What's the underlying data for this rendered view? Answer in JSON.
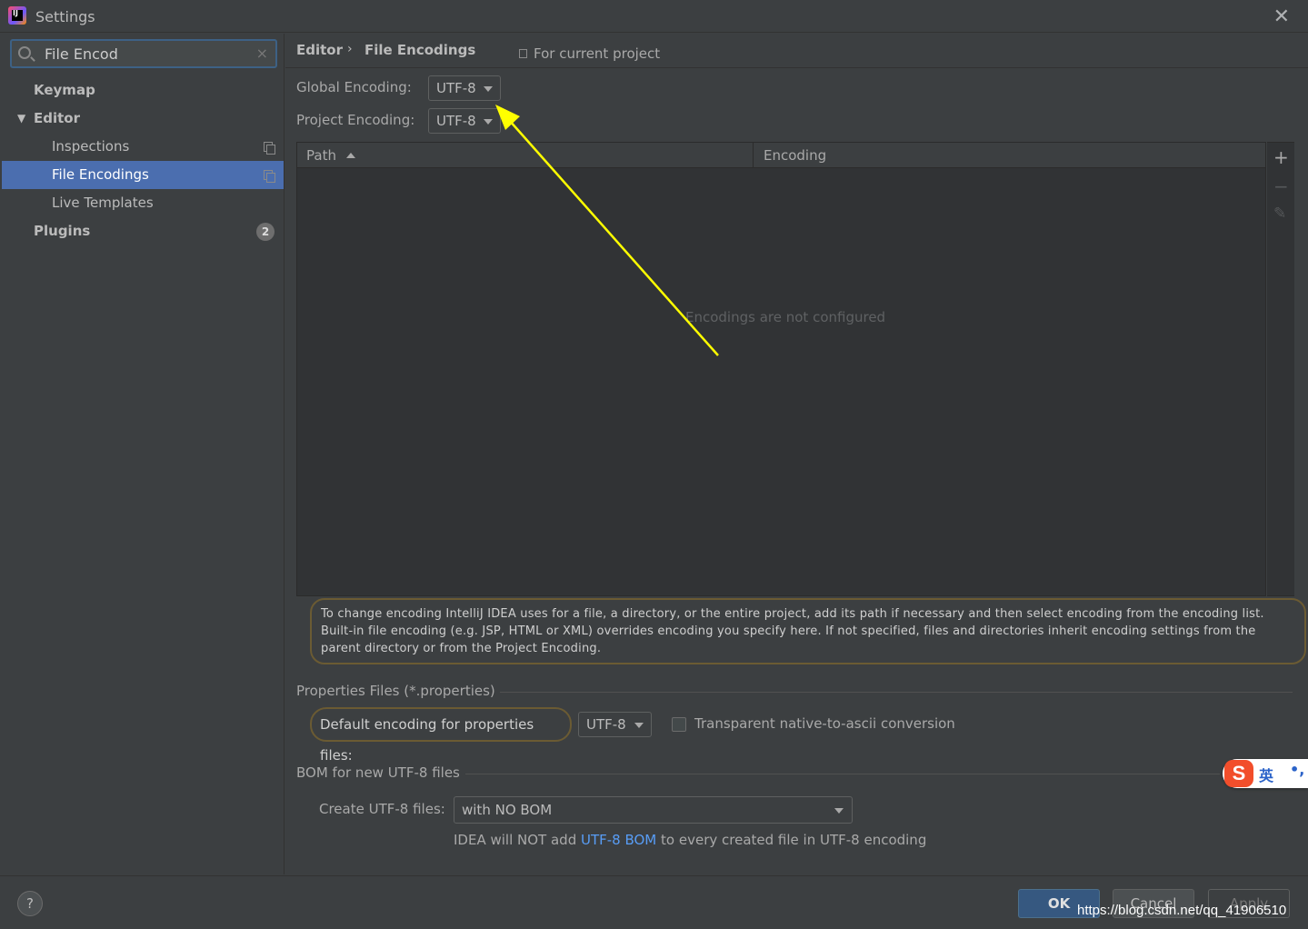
{
  "window": {
    "app_icon": "intellij-idea-icon",
    "title": "Settings",
    "close_glyph": "✕"
  },
  "search": {
    "value": "File Encod",
    "clear_glyph": "×"
  },
  "tree": [
    {
      "label": "Keymap",
      "bold": true,
      "indent": 0,
      "selected": false
    },
    {
      "label": "Editor",
      "bold": true,
      "indent": 0,
      "expanded": true,
      "selected": false
    },
    {
      "label": "Inspections",
      "bold": false,
      "indent": 1,
      "selected": false,
      "project_icon": true
    },
    {
      "label": "File Encodings",
      "bold": false,
      "indent": 1,
      "selected": true,
      "project_icon": true
    },
    {
      "label": "Live Templates",
      "bold": false,
      "indent": 1,
      "selected": false
    },
    {
      "label": "Plugins",
      "bold": true,
      "indent": 0,
      "selected": false,
      "badge": "2"
    }
  ],
  "tree_arrow_glyph": "▼",
  "breadcrumb": {
    "parent": "Editor",
    "separator": "›",
    "current": "File Encodings",
    "scope": "For current project"
  },
  "encodings": {
    "global_label": "Global Encoding:",
    "global_value": "UTF-8",
    "project_label": "Project Encoding:",
    "project_value": "UTF-8"
  },
  "table": {
    "col_path": "Path",
    "col_encoding": "Encoding",
    "empty_text": "Encodings are not configured",
    "add_glyph": "+",
    "remove_glyph": "−",
    "edit_glyph": "✎"
  },
  "info_text": "To change encoding IntelliJ IDEA uses for a file, a directory, or the entire project, add its path if necessary and then select encoding from the encoding list. Built-in file encoding (e.g. JSP, HTML or XML) overrides encoding you specify here. If not specified, files and directories inherit encoding settings from the parent directory or from the Project Encoding.",
  "properties": {
    "section_title": "Properties Files (*.properties)",
    "default_label": "Default encoding for properties files:",
    "default_value": "UTF-8",
    "transparent_label": "Transparent native-to-ascii conversion",
    "transparent_checked": false
  },
  "bom": {
    "section_title": "BOM for new UTF-8 files",
    "create_label": "Create UTF-8 files:",
    "create_value": "with NO BOM",
    "note_before": "IDEA will NOT add ",
    "note_link": "UTF-8 BOM",
    "note_after": " to every created file in UTF-8 encoding"
  },
  "footer": {
    "help_glyph": "?",
    "ok": "OK",
    "cancel": "Cancel",
    "apply": "Apply",
    "watermark": "https://blog.csdn.net/qq_41906510"
  },
  "ime": {
    "logo": "S",
    "mode": "英",
    "punct": "•,"
  },
  "colors": {
    "annotation_arrow": "#ffff00",
    "highlight_border": "#6b5b33",
    "selection": "#4b6eaf",
    "link": "#589df6"
  }
}
